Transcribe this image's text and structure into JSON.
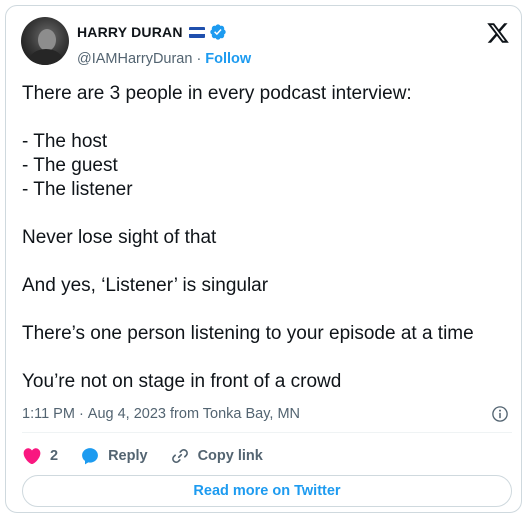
{
  "author": {
    "display_name": "HARRY DURAN",
    "handle": "@IAMHarryDuran",
    "separator": "·",
    "follow_label": "Follow"
  },
  "tweet": {
    "lines": [
      "There are 3 people in every podcast interview:",
      "",
      "- The host",
      "- The guest",
      "- The listener",
      "",
      "Never lose sight of that",
      "",
      "And yes, ‘Listener’ is singular",
      "",
      "There’s one person listening to your episode at a time",
      "",
      "You’re not on stage in front of a crowd"
    ]
  },
  "meta": {
    "time": "1:11 PM",
    "separator": "·",
    "date_location": "Aug 4, 2023 from Tonka Bay, MN"
  },
  "actions": {
    "like_count": "2",
    "reply_label": "Reply",
    "copy_link_label": "Copy link"
  },
  "read_more_label": "Read more on Twitter",
  "icons": {
    "flag": "el-salvador-flag-icon",
    "verified": "verified-badge-icon",
    "logo": "x-logo-icon",
    "info": "info-icon",
    "like": "heart-icon",
    "reply": "reply-bubble-icon",
    "copy": "link-icon"
  },
  "colors": {
    "accent": "#1d9bf0",
    "like": "#f91880",
    "text": "#0f1419",
    "muted": "#536471",
    "border": "#cfd9de"
  }
}
